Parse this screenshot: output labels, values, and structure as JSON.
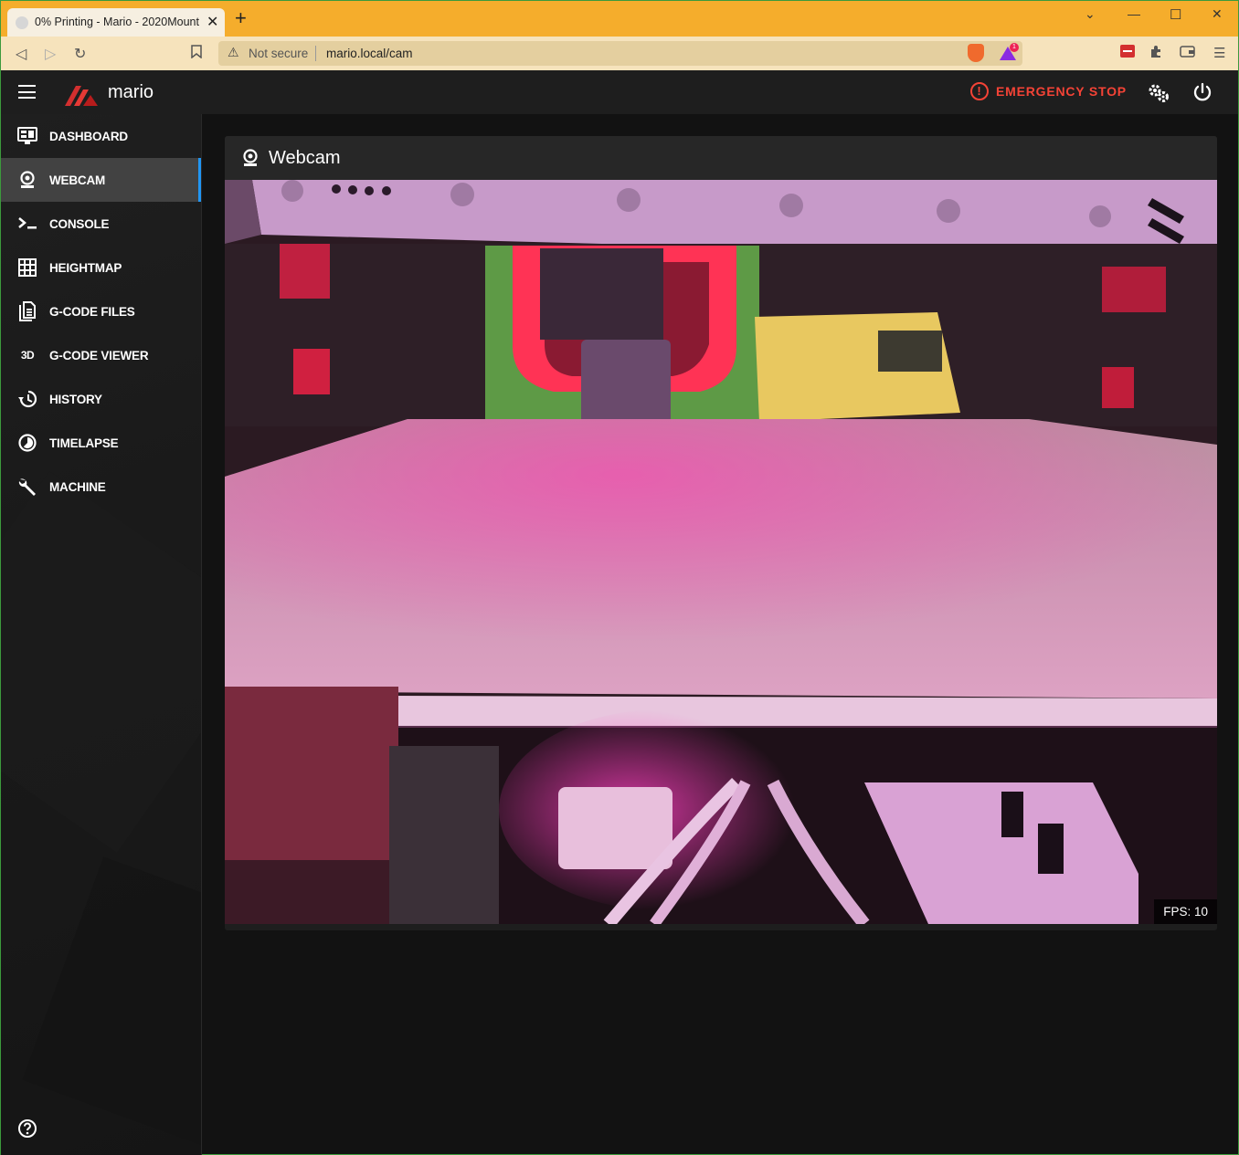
{
  "browser": {
    "tab_title": "0% Printing - Mario - 2020Mount",
    "new_tab": "+",
    "security_label": "Not secure",
    "url": "mario.local/cam",
    "brave_badge_count": "1"
  },
  "appbar": {
    "brand": "mario",
    "emergency_stop_label": "EMERGENCY STOP"
  },
  "sidebar": {
    "items": [
      {
        "label": "DASHBOARD",
        "icon": "monitor-dashboard-icon",
        "active": false
      },
      {
        "label": "WEBCAM",
        "icon": "webcam-icon",
        "active": true
      },
      {
        "label": "CONSOLE",
        "icon": "console-icon",
        "active": false
      },
      {
        "label": "HEIGHTMAP",
        "icon": "grid-icon",
        "active": false
      },
      {
        "label": "G-CODE FILES",
        "icon": "file-document-icon",
        "active": false
      },
      {
        "label": "G-CODE VIEWER",
        "icon": "3d-icon",
        "active": false
      },
      {
        "label": "HISTORY",
        "icon": "history-icon",
        "active": false
      },
      {
        "label": "TIMELAPSE",
        "icon": "timelapse-icon",
        "active": false
      },
      {
        "label": "MACHINE",
        "icon": "wrench-icon",
        "active": false
      }
    ],
    "icon_3d_text": "3D"
  },
  "main": {
    "panel_title": "Webcam",
    "fps_label": "FPS: 10"
  },
  "colors": {
    "accent": "#2196f3",
    "emergency": "#f44336",
    "tabstrip": "#f5ad2c",
    "background": "#121212"
  }
}
